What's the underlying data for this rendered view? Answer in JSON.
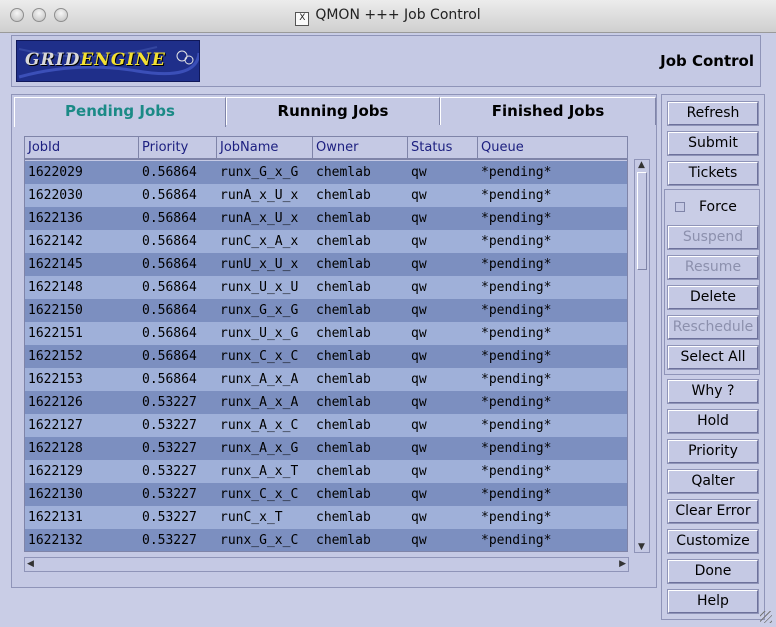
{
  "window": {
    "title": "QMON +++ Job Control",
    "x_icon": "X"
  },
  "header": {
    "logo_grid": "GRID",
    "logo_engine": "ENGINE",
    "title": "Job Control"
  },
  "tabs": [
    {
      "label": "Pending Jobs",
      "active": true
    },
    {
      "label": "Running Jobs",
      "active": false
    },
    {
      "label": "Finished Jobs",
      "active": false
    }
  ],
  "table": {
    "columns": [
      "JobId",
      "Priority",
      "JobName",
      "Owner",
      "Status",
      "Queue"
    ],
    "rows": [
      [
        "1622029",
        "0.56864",
        "runx_G_x_G",
        "chemlab",
        "qw",
        "*pending*"
      ],
      [
        "1622030",
        "0.56864",
        "runA_x_U_x",
        "chemlab",
        "qw",
        "*pending*"
      ],
      [
        "1622136",
        "0.56864",
        "runA_x_U_x",
        "chemlab",
        "qw",
        "*pending*"
      ],
      [
        "1622142",
        "0.56864",
        "runC_x_A_x",
        "chemlab",
        "qw",
        "*pending*"
      ],
      [
        "1622145",
        "0.56864",
        "runU_x_U_x",
        "chemlab",
        "qw",
        "*pending*"
      ],
      [
        "1622148",
        "0.56864",
        "runx_U_x_U",
        "chemlab",
        "qw",
        "*pending*"
      ],
      [
        "1622150",
        "0.56864",
        "runx_G_x_G",
        "chemlab",
        "qw",
        "*pending*"
      ],
      [
        "1622151",
        "0.56864",
        "runx_U_x_G",
        "chemlab",
        "qw",
        "*pending*"
      ],
      [
        "1622152",
        "0.56864",
        "runx_C_x_C",
        "chemlab",
        "qw",
        "*pending*"
      ],
      [
        "1622153",
        "0.56864",
        "runx_A_x_A",
        "chemlab",
        "qw",
        "*pending*"
      ],
      [
        "1622126",
        "0.53227",
        "runx_A_x_A",
        "chemlab",
        "qw",
        "*pending*"
      ],
      [
        "1622127",
        "0.53227",
        "runx_A_x_C",
        "chemlab",
        "qw",
        "*pending*"
      ],
      [
        "1622128",
        "0.53227",
        "runx_A_x_G",
        "chemlab",
        "qw",
        "*pending*"
      ],
      [
        "1622129",
        "0.53227",
        "runx_A_x_T",
        "chemlab",
        "qw",
        "*pending*"
      ],
      [
        "1622130",
        "0.53227",
        "runx_C_x_C",
        "chemlab",
        "qw",
        "*pending*"
      ],
      [
        "1622131",
        "0.53227",
        "runC_x_T",
        "chemlab",
        "qw",
        "*pending*"
      ],
      [
        "1622132",
        "0.53227",
        "runx_G_x_C",
        "chemlab",
        "qw",
        "*pending*"
      ]
    ]
  },
  "buttons": {
    "refresh": "Refresh",
    "submit": "Submit",
    "tickets": "Tickets",
    "force": "Force",
    "suspend": "Suspend",
    "resume": "Resume",
    "delete": "Delete",
    "reschedule": "Reschedule",
    "select_all": "Select All",
    "why": "Why ?",
    "hold": "Hold",
    "priority": "Priority",
    "qalter": "Qalter",
    "clear_error": "Clear Error",
    "customize": "Customize",
    "done": "Done",
    "help": "Help"
  },
  "force_checked": false
}
